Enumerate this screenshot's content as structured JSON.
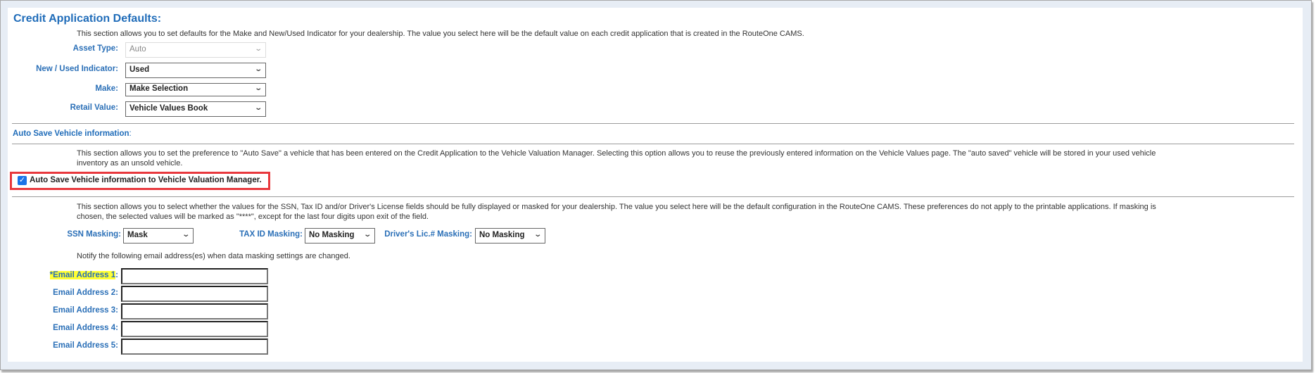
{
  "credit_defaults": {
    "title": "Credit Application Defaults:",
    "description": "This section allows you to set defaults for the Make and New/Used Indicator for your dealership. The value you select here will be the default value on each credit application that is created in the RouteOne CAMS.",
    "fields": [
      {
        "label": "Asset Type:",
        "value": "Auto",
        "disabled": true
      },
      {
        "label": "New / Used Indicator:",
        "value": "Used",
        "disabled": false
      },
      {
        "label": "Make:",
        "value": "Make Selection",
        "disabled": false
      },
      {
        "label": "Retail Value:",
        "value": "Vehicle Values Book",
        "disabled": false
      }
    ]
  },
  "auto_save": {
    "heading": "Auto Save Vehicle information",
    "heading_colon": ":",
    "description_line1": "This section allows you to set the preference to \"Auto Save\" a vehicle that has been entered on the Credit Application to the Vehicle Valuation Manager. Selecting this option allows you to reuse the previously entered information on the Vehicle Values page. The \"auto saved\" vehicle will be stored in your used vehicle",
    "description_line2": "inventory as an unsold vehicle.",
    "checkbox_label": "Auto Save Vehicle information to Vehicle Valuation Manager.",
    "checkbox_checked": true,
    "checkmark": "✓",
    "highlight_color": "#e8383d"
  },
  "masking": {
    "description_line1": "This section allows you to select whether the values for the SSN, Tax ID and/or Driver's License fields should be fully displayed or masked for your dealership. The value you select here will be the default configuration in the RouteOne CAMS. These preferences do not apply to the printable applications. If masking is",
    "description_line2": "chosen, the selected values will be marked as \"****\", except for the last four digits upon exit of the field.",
    "ssn": {
      "label": "SSN Masking:",
      "value": "Mask"
    },
    "tax_id": {
      "label": "TAX ID Masking:",
      "value": "No Masking"
    },
    "drivers_lic": {
      "label": "Driver's Lic.# Masking:",
      "value": "No Masking"
    },
    "notify_text": "Notify the following email address(es) when data masking settings are changed.",
    "emails": [
      {
        "label": "*Email Address 1",
        "colon": ":",
        "value": "",
        "required": true
      },
      {
        "label": "Email Address 2:",
        "value": ""
      },
      {
        "label": "Email Address 3:",
        "value": ""
      },
      {
        "label": "Email Address 4:",
        "value": ""
      },
      {
        "label": "Email Address 5:",
        "value": ""
      }
    ]
  },
  "icons": {
    "dropdown": "chevron-down-icon",
    "chevron_glyph": "⌄"
  },
  "colors": {
    "label_blue": "#2a6fb7",
    "title_blue": "#1f6cb9",
    "required_highlight": "#ffff33"
  }
}
